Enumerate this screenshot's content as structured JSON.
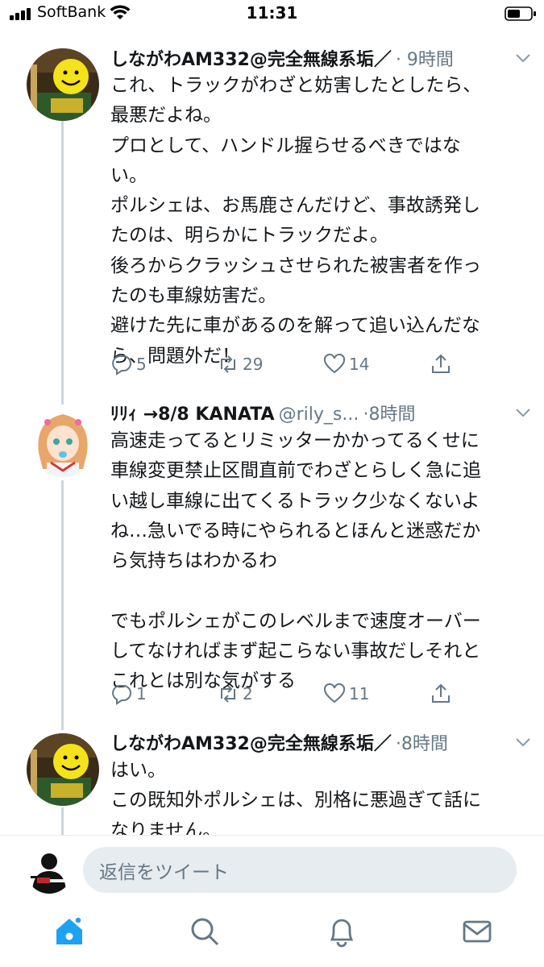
{
  "status_bar": {
    "carrier": "SoftBank",
    "time": "11:31"
  },
  "tweets": [
    {
      "name": "しながわAM332@完全無線系垢／",
      "handle": "",
      "time": "· 9時間",
      "body": "これ、トラックがわざと妨害したとしたら、\n最悪だよね。\nプロとして、ハンドル握らせるべきではな\nい。\nポルシェは、お馬鹿さんだけど、事故誘発し\nたのは、明らかにトラックだよ。\n後ろからクラッシュさせられた被害者を作っ\nたのも車線妨害だ。\n避けた先に車があるのを解って追い込んだな\nら、問題外だ！",
      "replies": "5",
      "retweets": "29",
      "likes": "14"
    },
    {
      "name": "ﾘﾘｨ →8/8 KANATA",
      "handle": "@rily_s...",
      "time": "·8時間",
      "body": "高速走ってるとリミッターかかってるくせに\n車線変更禁止区間直前でわざとらしく急に追\nい越し車線に出てくるトラック少なくないよ\nね…急いでる時にやられるとほんと迷惑だか\nら気持ちはわかるわ\n\nでもポルシェがこのレベルまで速度オーバー\nしてなければまず起こらない事故だしそれと\nこれとは別な気がする",
      "replies": "1",
      "retweets": "2",
      "likes": "11"
    },
    {
      "name": "しながわAM332@完全無線系垢／",
      "handle": "",
      "time": "·8時間",
      "body": "はい。\nこの既知外ポルシェは、別格に悪過ぎて話に\nなりません。"
    }
  ],
  "reply_bar": {
    "placeholder": "返信をツイート"
  },
  "tabs": [
    "home-icon",
    "search-icon",
    "notifications-icon",
    "messages-icon"
  ],
  "colors": {
    "accent": "#1da1f2",
    "secondary_text": "#657786",
    "thread_line": "#ccd6dd"
  }
}
